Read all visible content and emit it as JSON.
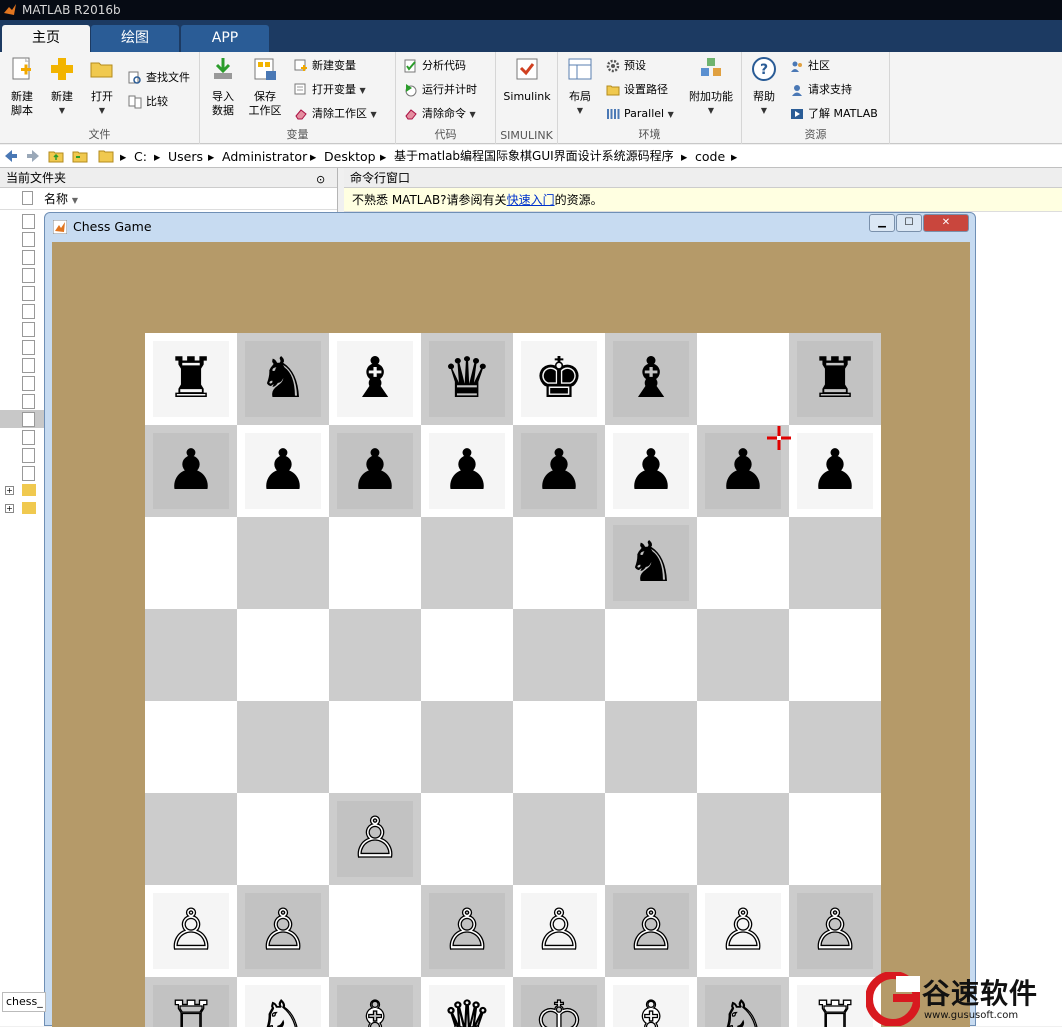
{
  "app": {
    "title": "MATLAB R2016b"
  },
  "tabs": [
    {
      "label": "主页"
    },
    {
      "label": "绘图"
    },
    {
      "label": "APP"
    }
  ],
  "ribbon": {
    "file": {
      "group_label": "文件",
      "new_script": "新建\n脚本",
      "new": "新建",
      "open": "打开",
      "find_files": "查找文件",
      "compare": "比较"
    },
    "variable": {
      "group_label": "变量",
      "import": "导入\n数据",
      "save_ws": "保存\n工作区",
      "new_var": "新建变量",
      "open_var": "打开变量",
      "clear_ws": "清除工作区"
    },
    "code": {
      "group_label": "代码",
      "analyze": "分析代码",
      "run_time": "运行并计时",
      "clear_cmd": "清除命令"
    },
    "simulink": {
      "group_label": "SIMULINK",
      "simulink": "Simulink"
    },
    "env": {
      "group_label": "环境",
      "layout": "布局",
      "prefs": "预设",
      "set_path": "设置路径",
      "parallel": "Parallel",
      "addons": "附加功能"
    },
    "resources": {
      "group_label": "资源",
      "help": "帮助",
      "community": "社区",
      "support": "请求支持",
      "learn": "了解 MATLAB"
    }
  },
  "address": {
    "crumbs": [
      "C:",
      "Users",
      "Administrator",
      "Desktop",
      "基于matlab编程国际象棋GUI界面设计系统源码程序",
      "code"
    ]
  },
  "current_folder": {
    "title": "当前文件夹",
    "col_name": "名称",
    "status": "chess_"
  },
  "command_window": {
    "title": "命令行窗口",
    "banner_prefix": "不熟悉 MATLAB?请参阅有关",
    "banner_link": "快速入门",
    "banner_suffix": "的资源。"
  },
  "chess_window": {
    "title": "Chess Game"
  },
  "board": {
    "rows": [
      [
        "♜",
        "♞",
        "♝",
        "♛",
        "♚",
        "♝",
        "",
        "♜"
      ],
      [
        "♟",
        "♟",
        "♟",
        "♟",
        "♟",
        "♟",
        "♟",
        "♟"
      ],
      [
        "",
        "",
        "",
        "",
        "",
        "♞",
        "",
        ""
      ],
      [
        "",
        "",
        "",
        "",
        "",
        "",
        "",
        ""
      ],
      [
        "",
        "",
        "",
        "",
        "",
        "",
        "",
        ""
      ],
      [
        "",
        "",
        "♙",
        "",
        "",
        "",
        "",
        ""
      ],
      [
        "♙",
        "♙",
        "",
        "♙",
        "♙",
        "♙",
        "♙",
        "♙"
      ],
      [
        "♖",
        "♘",
        "♗",
        "♕",
        "♔",
        "♗",
        "♘",
        "♖"
      ]
    ]
  },
  "watermark": {
    "name": "谷速软件",
    "url": "www.gususoft.com"
  }
}
